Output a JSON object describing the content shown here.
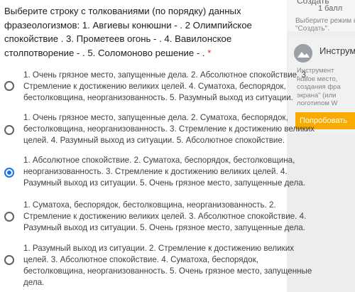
{
  "question": {
    "text": "Выберите строку с толкованиями (по порядку) данных фразеологизмов: 1. Авгиевы конюшни - . 2 Олимпийское спокойствие . 3. Прометеев огонь - . 4. Вавилонское столпотворение - . 5. Соломоново решение - .",
    "required_mark": "*"
  },
  "side_panel": {
    "create_label": "Создать",
    "score": "1 балл",
    "hint": "Выберите режим но\n\"Создать\".",
    "card_title": "Инструме",
    "card_text": "Инструмент \nновое место,\nсоздания фра\nэкрана\" (или\nлоготипом W",
    "card_button": "Попробовать"
  },
  "options": [
    {
      "text": "1. Очень грязное место, запущенные дела. 2. Абсолютное спокойствие. 3. Стремление к достижению великих целей. 4. Суматоха, беспорядок, бестолковщина, неорганизованность. 5. Разумный выход из ситуации.",
      "selected": false
    },
    {
      "text": "1. Очень грязное место, запущенные дела. 2. Суматоха, беспорядок, бестолковщина, неорганизованность. 3. Стремление к достижению великих целей. 4. Разумный выход из ситуации. 5. Абсолютное спокойствие.",
      "selected": false
    },
    {
      "text": "1. Абсолютное спокойствие. 2. Суматоха, беспорядок, бестолковщина, неорганизованность. 3. Стремление к достижению великих целей. 4. Разумный выход из ситуации. 5. Очень грязное место, запущенные дела.",
      "selected": true
    },
    {
      "text": "1. Суматоха, беспорядок, бестолковщина, неорганизованность. 2. Стремление к достижению великих целей. 3. Абсолютное спокойствие. 4. Разумный выход из ситуации. 5. Очень грязное место, запущенные дела.",
      "selected": false
    },
    {
      "text": "1. Разумный выход из ситуации. 2. Стремление к достижению великих целей. 3. Абсолютное спокойствие. 4. Суматоха, беспорядок, бестолковщина, неорганизованность. 5. Очень грязное место, запущенные дела.",
      "selected": false
    }
  ],
  "colors": {
    "accent": "#1a73e8",
    "required": "#d93025",
    "button": "#f9ab00"
  }
}
